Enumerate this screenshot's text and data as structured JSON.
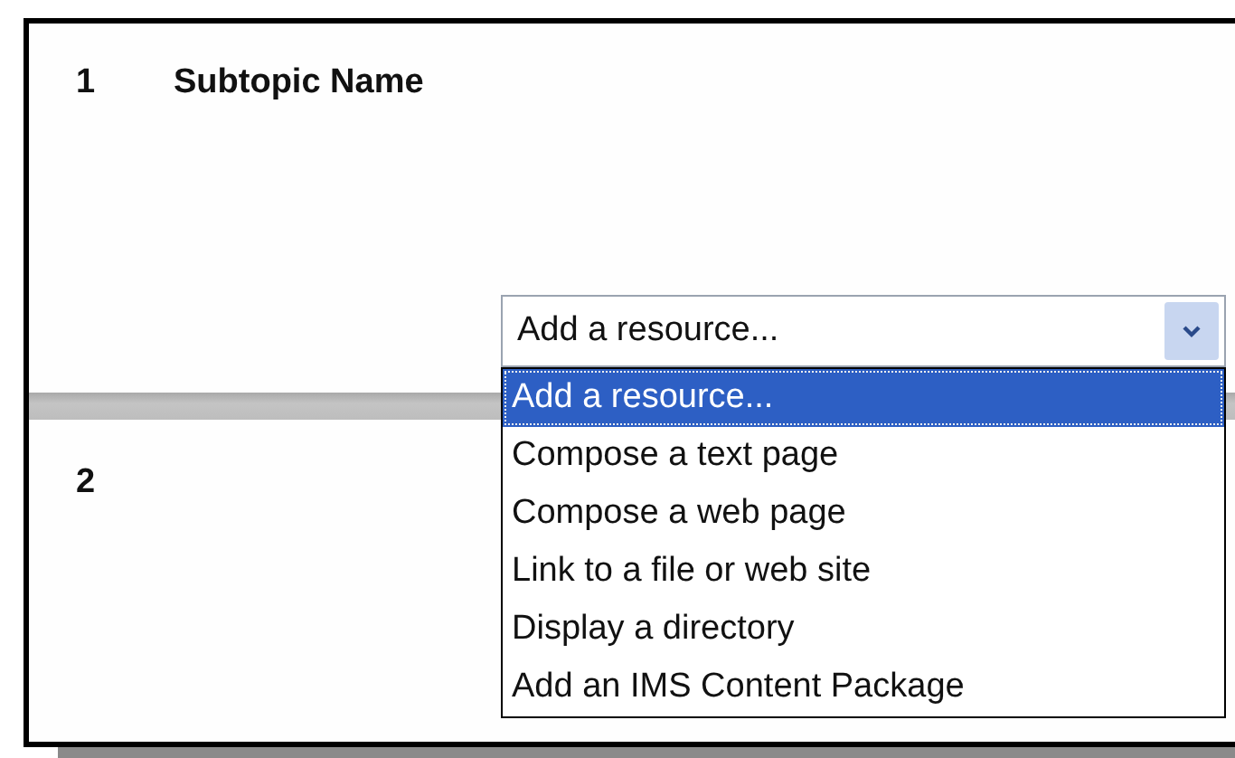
{
  "sections": [
    {
      "number": "1",
      "title": "Subtopic Name"
    },
    {
      "number": "2"
    }
  ],
  "resource_select": {
    "value": "Add a resource...",
    "expanded": true,
    "options": [
      {
        "label": "Add a resource...",
        "selected": true
      },
      {
        "label": "Compose a text page",
        "selected": false
      },
      {
        "label": "Compose a web page",
        "selected": false
      },
      {
        "label": "Link to a file or web site",
        "selected": false
      },
      {
        "label": "Display a directory",
        "selected": false
      },
      {
        "label": "Add an IMS Content Package",
        "selected": false
      }
    ]
  }
}
